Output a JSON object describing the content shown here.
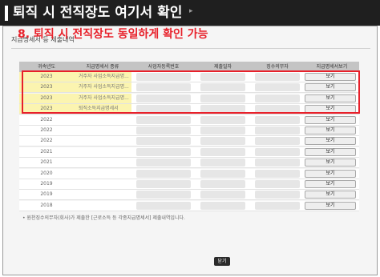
{
  "banner": {
    "title": "퇴직 시 전직장도 여기서 확인",
    "marker": "▸"
  },
  "window": {
    "title": "지급명세서 등 제출내역"
  },
  "callout": "8. 퇴직 시 전직장도 동일하게 확인 가능",
  "table": {
    "headers": [
      "귀속년도",
      "지급명세서 종류",
      "사업자등록번호",
      "제출일자",
      "징수의무자",
      "지급명세서보기"
    ],
    "view_label": "보기",
    "rows": [
      {
        "year": "2023",
        "type": "거주자 사업소득지급명...",
        "highlight": true
      },
      {
        "year": "2023",
        "type": "거주자 사업소득지급명...",
        "highlight": true
      },
      {
        "year": "2023",
        "type": "거주자 사업소득지급명...",
        "highlight": true
      },
      {
        "year": "2023",
        "type": "퇴직소득지급명세서",
        "highlight": true
      },
      {
        "year": "2022",
        "type": "",
        "highlight": false
      },
      {
        "year": "2022",
        "type": "",
        "highlight": false
      },
      {
        "year": "2022",
        "type": "",
        "highlight": false
      },
      {
        "year": "2021",
        "type": "",
        "highlight": false
      },
      {
        "year": "2021",
        "type": "",
        "highlight": false
      },
      {
        "year": "2020",
        "type": "",
        "highlight": false
      },
      {
        "year": "2019",
        "type": "",
        "highlight": false
      },
      {
        "year": "2019",
        "type": "",
        "highlight": false
      },
      {
        "year": "2018",
        "type": "",
        "highlight": false
      }
    ]
  },
  "notice": "• 원천징수의무자(회사)가 제출한 [근로소득 등 각종지급명세서] 제출내역입니다.",
  "close_label": "닫기",
  "colors": {
    "banner": "#1f1f1f",
    "highlight_border": "#e8202a",
    "highlight_fill": "#fbf4b0",
    "header_fill": "#c4c4c4"
  }
}
